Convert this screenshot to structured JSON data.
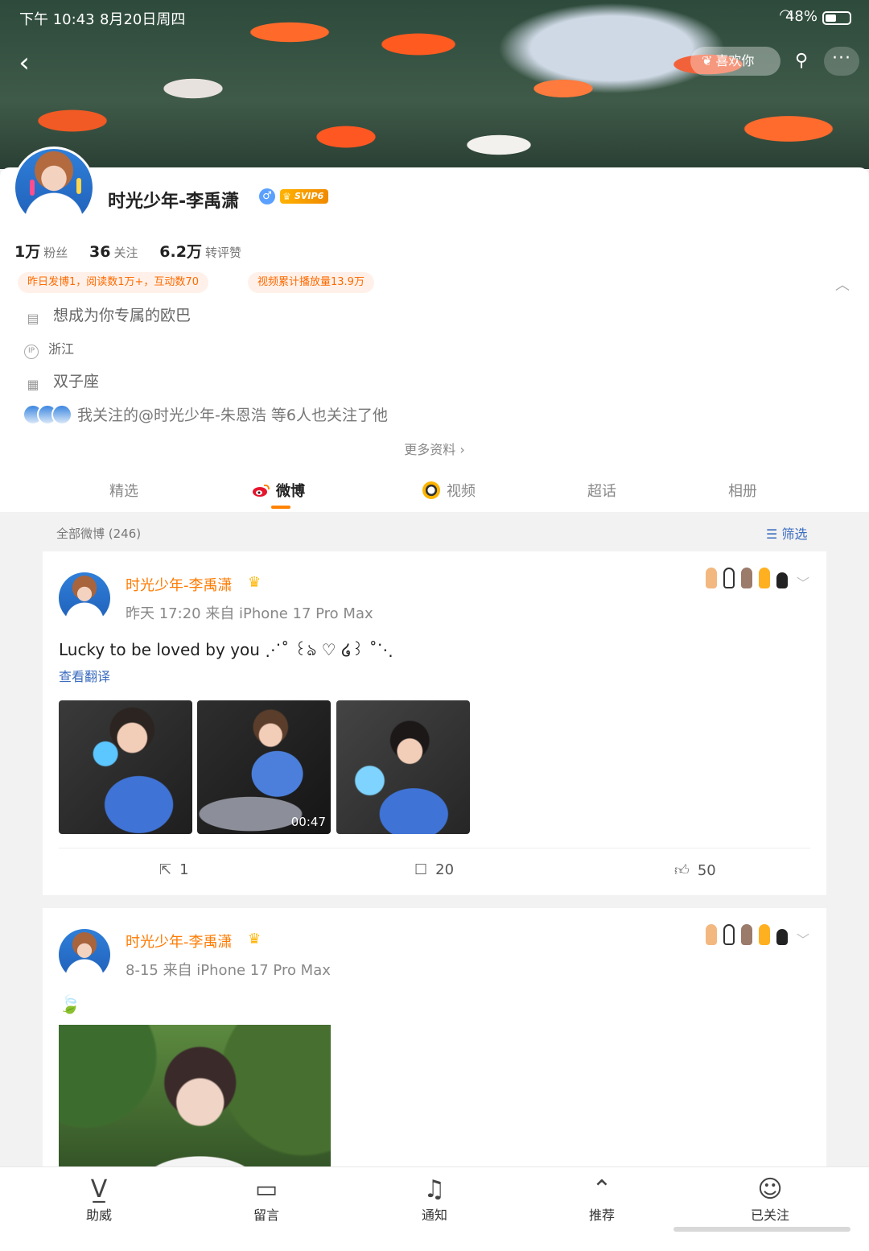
{
  "statusbar": {
    "time": "下午 10:43",
    "date": "8月20日周四",
    "battery": "48%"
  },
  "header": {
    "like_label": "喜欢你"
  },
  "profile": {
    "name": "时光少年-李禹潇",
    "gender_symbol": "♂",
    "svip": "SVIP6",
    "stats": [
      {
        "num": "1万",
        "label": "粉丝"
      },
      {
        "num": "36",
        "label": "关注"
      },
      {
        "num": "6.2万",
        "label": "转评赞"
      }
    ],
    "tags": [
      "昨日发博1，阅读数1万+，互动数70",
      "视频累计播放量13.9万"
    ],
    "bio": "想成为你专属的欧巴",
    "ip_label": "IP",
    "location": "浙江",
    "constellation": "双子座",
    "follow_note": "我关注的@时光少年-朱恩浩 等6人也关注了他",
    "more_info": "更多资料 ›"
  },
  "tabs": [
    "精选",
    "微博",
    "视频",
    "超话",
    "相册"
  ],
  "feed": {
    "count_label": "全部微博 (246)",
    "filter_label": "筛选"
  },
  "posts": [
    {
      "name": "时光少年-李禹潇",
      "meta": "昨天 17:20   来自 iPhone 17 Pro Max",
      "text": "Lucky to be loved by you ⋰˚ ꒰ঌ ♡ ໒꒱ ˚⋱",
      "translate": "查看翻译",
      "duration": "00:47",
      "reposts": "1",
      "comments": "20",
      "likes": "50"
    },
    {
      "name": "时光少年-李禹潇",
      "meta": "8-15   来自 iPhone 17 Pro Max",
      "text": "🍃"
    }
  ],
  "bottombar": [
    {
      "label": "助威",
      "icon": "boost-icon"
    },
    {
      "label": "留言",
      "icon": "message-icon"
    },
    {
      "label": "通知",
      "icon": "bell-plus-icon"
    },
    {
      "label": "推荐",
      "icon": "recommend-icon"
    },
    {
      "label": "已关注",
      "icon": "user-check-icon"
    }
  ],
  "colors": {
    "accent": "#ff8200",
    "name_orange": "#ff7a00",
    "link_blue": "#3b6cbf",
    "tag_bg": "#fff1e9"
  }
}
